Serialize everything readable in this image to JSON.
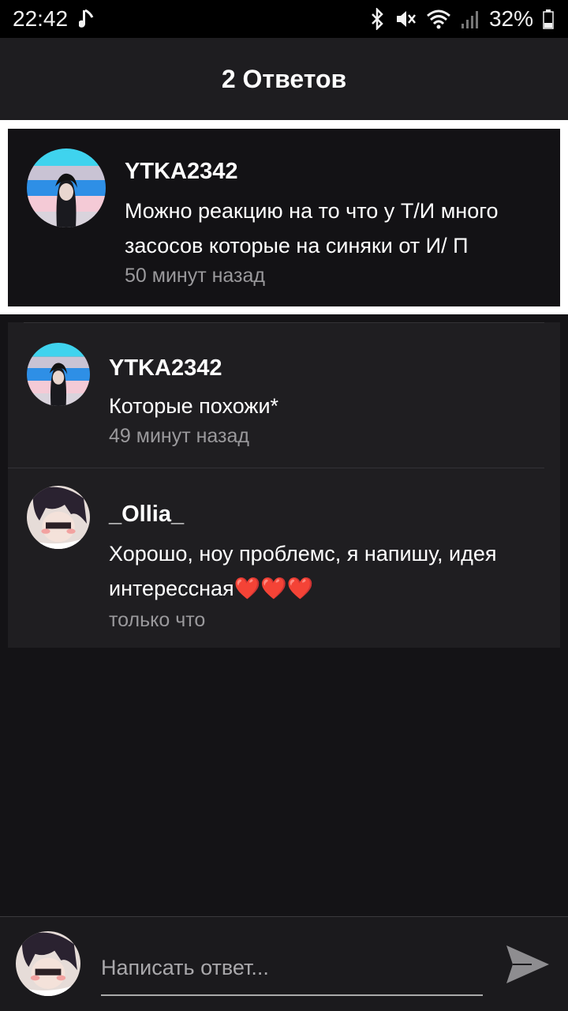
{
  "status": {
    "time": "22:42",
    "battery": "32%",
    "icons": [
      "music-note-icon",
      "bluetooth-icon",
      "mute-icon",
      "wifi-icon",
      "signal-icon",
      "battery-icon"
    ]
  },
  "header": {
    "title": "2 Ответов"
  },
  "highlighted": {
    "username": "YTKA2342",
    "text_line1": "Можно реакцию на то что у Т/И много",
    "text_line2": "засосов которые на синяки от И/ П",
    "time": "50 минут назад"
  },
  "replies": [
    {
      "username": "YTKA2342",
      "text_line1": "Которые похожи*",
      "text_line2": "",
      "time": "49 минут назад"
    },
    {
      "username": "_Ollia_",
      "text_line1": "Хорошо, ноу проблемс, я напишу, идея",
      "text_line2": "интерессная❤️❤️❤️",
      "time": "только что"
    }
  ],
  "composer": {
    "placeholder": "Написать ответ..."
  },
  "colors": {
    "background": "#141316",
    "card": "#1f1e21",
    "highlight_border": "#ffffff",
    "muted_text": "#9a999c"
  }
}
